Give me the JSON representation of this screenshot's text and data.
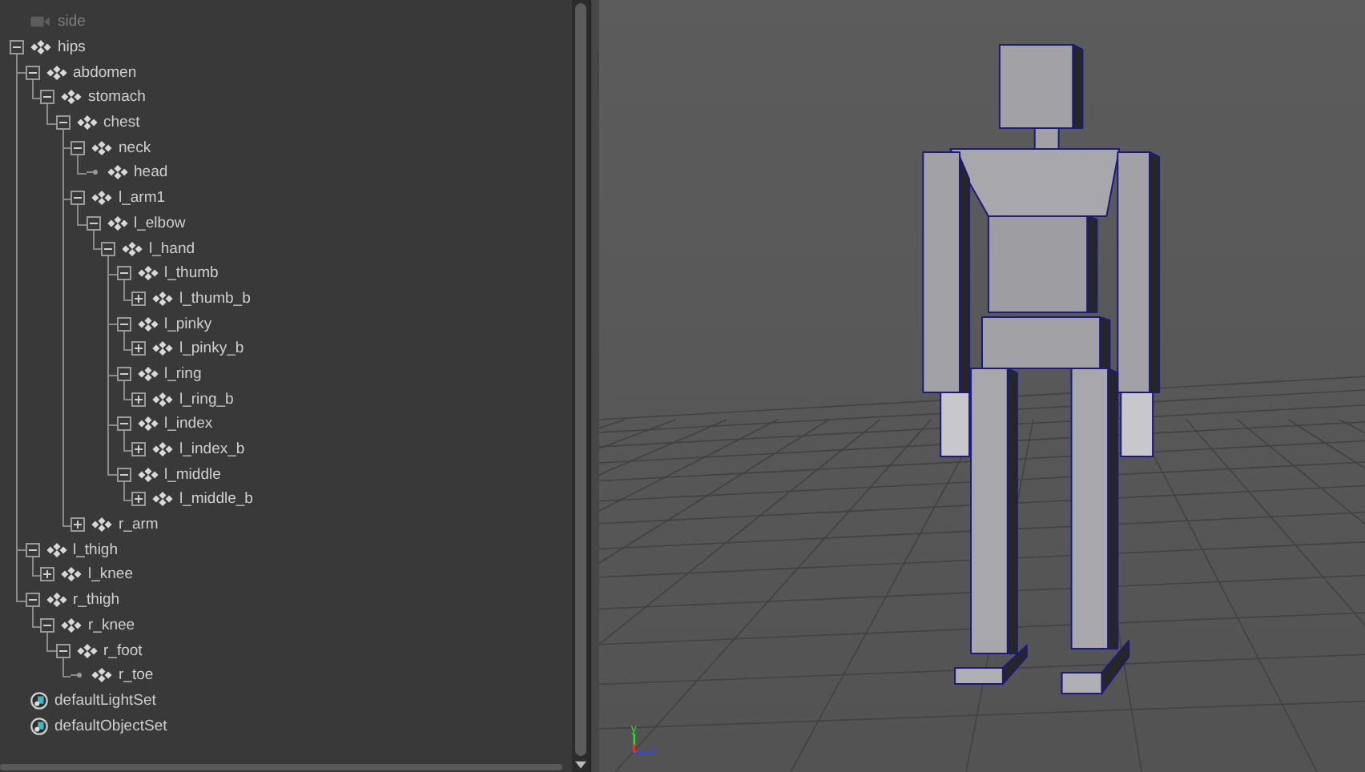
{
  "outliner": {
    "items": [
      {
        "label": "side",
        "kind": "camera",
        "hidden": true
      },
      {
        "label": "hips",
        "kind": "joint",
        "hidden": false,
        "expanded": true,
        "children": [
          {
            "label": "abdomen",
            "kind": "joint",
            "expanded": true,
            "children": [
              {
                "label": "stomach",
                "kind": "joint",
                "expanded": true,
                "children": [
                  {
                    "label": "chest",
                    "kind": "joint",
                    "expanded": true,
                    "children": [
                      {
                        "label": "neck",
                        "kind": "joint",
                        "expanded": true,
                        "children": [
                          {
                            "label": "head",
                            "kind": "end_joint"
                          }
                        ]
                      },
                      {
                        "label": "l_arm1",
                        "kind": "joint",
                        "expanded": true,
                        "children": [
                          {
                            "label": "l_elbow",
                            "kind": "joint",
                            "expanded": true,
                            "children": [
                              {
                                "label": "l_hand",
                                "kind": "joint",
                                "expanded": true,
                                "children": [
                                  {
                                    "label": "l_thumb",
                                    "kind": "joint",
                                    "expanded": true,
                                    "children": [
                                      {
                                        "label": "l_thumb_b",
                                        "kind": "joint",
                                        "expanded": false
                                      }
                                    ]
                                  },
                                  {
                                    "label": "l_pinky",
                                    "kind": "joint",
                                    "expanded": true,
                                    "children": [
                                      {
                                        "label": "l_pinky_b",
                                        "kind": "joint",
                                        "expanded": false
                                      }
                                    ]
                                  },
                                  {
                                    "label": "l_ring",
                                    "kind": "joint",
                                    "expanded": true,
                                    "children": [
                                      {
                                        "label": "l_ring_b",
                                        "kind": "joint",
                                        "expanded": false
                                      }
                                    ]
                                  },
                                  {
                                    "label": "l_index",
                                    "kind": "joint",
                                    "expanded": true,
                                    "children": [
                                      {
                                        "label": "l_index_b",
                                        "kind": "joint",
                                        "expanded": false
                                      }
                                    ]
                                  },
                                  {
                                    "label": "l_middle",
                                    "kind": "joint",
                                    "expanded": true,
                                    "children": [
                                      {
                                        "label": "l_middle_b",
                                        "kind": "joint",
                                        "expanded": false
                                      }
                                    ]
                                  }
                                ]
                              }
                            ]
                          }
                        ]
                      },
                      {
                        "label": "r_arm",
                        "kind": "joint",
                        "expanded": false
                      }
                    ]
                  }
                ]
              }
            ]
          },
          {
            "label": "l_thigh",
            "kind": "joint",
            "expanded": true,
            "children": [
              {
                "label": "l_knee",
                "kind": "joint",
                "expanded": false
              }
            ]
          },
          {
            "label": "r_thigh",
            "kind": "joint",
            "expanded": true,
            "children": [
              {
                "label": "r_knee",
                "kind": "joint",
                "expanded": true,
                "children": [
                  {
                    "label": "r_foot",
                    "kind": "joint",
                    "expanded": true,
                    "children": [
                      {
                        "label": "r_toe",
                        "kind": "end_joint"
                      }
                    ]
                  }
                ]
              }
            ]
          }
        ]
      },
      {
        "label": "defaultLightSet",
        "kind": "set",
        "hidden": false
      },
      {
        "label": "defaultObjectSet",
        "kind": "set",
        "hidden": false
      }
    ]
  },
  "viewport": {
    "axes": [
      "y",
      "z"
    ]
  }
}
